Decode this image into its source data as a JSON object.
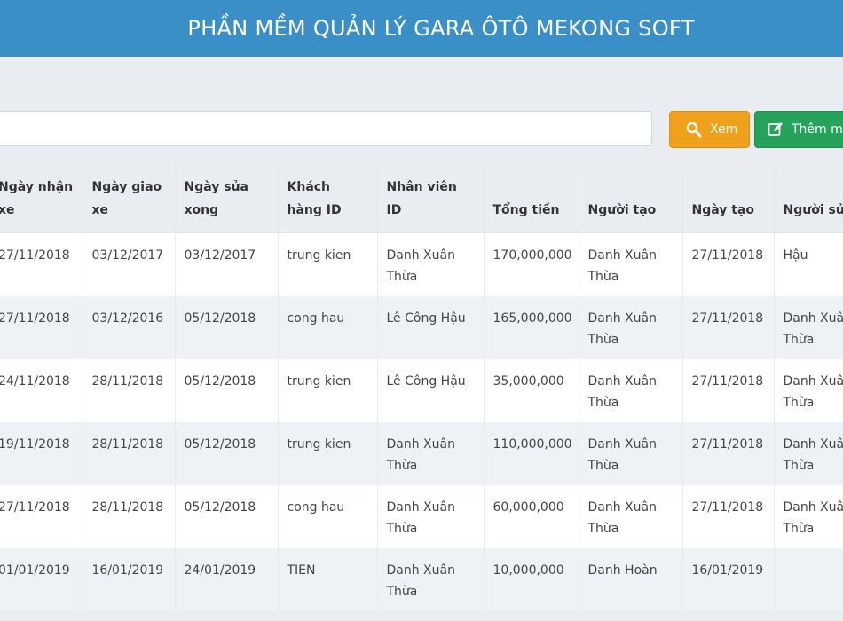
{
  "header": {
    "title": "PHẦN MỀM QUẢN LÝ GARA ÔTÔ MEKONG SOFT"
  },
  "search": {
    "value": "",
    "placeholder": ""
  },
  "buttons": {
    "view_label": "Xem",
    "add_label": "Thêm m",
    "view_icon": "search-icon",
    "add_icon": "edit-icon"
  },
  "colors": {
    "header": "#3a8fc7",
    "view_button": "#f0a11c",
    "add_button": "#25a35a"
  },
  "table": {
    "columns": [
      "Ngày nhận xe",
      "Ngày giao xe",
      "Ngày sửa xong",
      "Khách hàng ID",
      "Nhân viên ID",
      "Tổng tiền",
      "Người tạo",
      "Ngày tạo",
      "Người sửa"
    ],
    "rows": [
      [
        "27/11/2018",
        "03/12/2017",
        "03/12/2017",
        "trung kien",
        "Danh Xuân Thừa",
        "170,000,000",
        "Danh Xuân Thừa",
        "27/11/2018",
        "Hậu"
      ],
      [
        "27/11/2018",
        "03/12/2016",
        "05/12/2018",
        "cong hau",
        "Lê Công Hậu",
        "165,000,000",
        "Danh Xuân Thừa",
        "27/11/2018",
        "Danh Xuân Thừa"
      ],
      [
        "24/11/2018",
        "28/11/2018",
        "05/12/2018",
        "trung kien",
        "Lê Công Hậu",
        "35,000,000",
        "Danh Xuân Thừa",
        "27/11/2018",
        "Danh Xuân Thừa"
      ],
      [
        "19/11/2018",
        "28/11/2018",
        "05/12/2018",
        "trung kien",
        "Danh Xuân Thừa",
        "110,000,000",
        "Danh Xuân Thừa",
        "27/11/2018",
        "Danh Xuân Thừa"
      ],
      [
        "27/11/2018",
        "28/11/2018",
        "05/12/2018",
        "cong hau",
        "Danh Xuân Thừa",
        "60,000,000",
        "Danh Xuân Thừa",
        "27/11/2018",
        "Danh Xuân Thừa"
      ],
      [
        "01/01/2019",
        "16/01/2019",
        "24/01/2019",
        "TIEN",
        "Danh Xuân Thừa",
        "10,000,000",
        "Danh Hoàn",
        "16/01/2019",
        ""
      ]
    ]
  }
}
